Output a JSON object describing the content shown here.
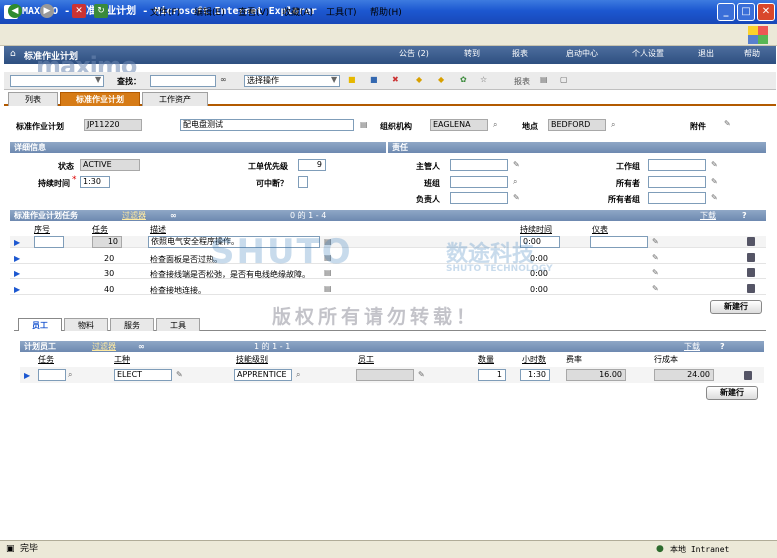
{
  "window": {
    "title": "MAXIMO - 标准作业计划 - Microsoft Internet Explorer"
  },
  "menu": [
    "文件(F)",
    "编辑(E)",
    "查看(V)",
    "收藏(A)",
    "工具(T)",
    "帮助(H)"
  ],
  "app": {
    "title": "标准作业计划",
    "logo": "maximo",
    "header_links": [
      "公告 (2)",
      "转到",
      "报表",
      "启动中心",
      "个人设置",
      "退出",
      "帮助"
    ]
  },
  "toolbar": {
    "find_label": "查找：",
    "action_value": "选择操作",
    "report_label": "报表"
  },
  "tabs": [
    "列表",
    "标准作业计划",
    "工作资产"
  ],
  "main": {
    "jobplan_label": "标准作业计划",
    "jobplan_value": "JP11220",
    "desc_value": "配电盘测试",
    "org_label": "组织机构",
    "org_value": "EAGLENA",
    "site_label": "地点",
    "site_value": "BEDFORD",
    "attach_label": "附件"
  },
  "details": {
    "title": "详细信息",
    "status_label": "状态",
    "status_value": "ACTIVE",
    "duration_label": "持续时间",
    "duration_value": "1:30",
    "priority_label": "工单优先级",
    "priority_value": "9",
    "interrupt_label": "可中断？"
  },
  "responsibility": {
    "title": "责任",
    "supervisor": "主管人",
    "crew": "班组",
    "lead": "负责人",
    "workgroup": "工作组",
    "owner": "所有者",
    "ownergroup": "所有者组"
  },
  "tasks": {
    "title": "标准作业计划任务",
    "filter": "过滤器",
    "pager": "0 的 1 - 4",
    "download": "下载",
    "columns": [
      "序号",
      "任务",
      "描述",
      "持续时间",
      "仪表"
    ],
    "rows": [
      {
        "task": "10",
        "desc": "依照电气安全程序操作。",
        "duration": "0:00"
      },
      {
        "task": "20",
        "desc": "检查面板是否过热。",
        "duration": "0:00"
      },
      {
        "task": "30",
        "desc": "检查接线端是否松弛，是否有电线绝缘故障。",
        "duration": "0:00"
      },
      {
        "task": "40",
        "desc": "检查接地连接。",
        "duration": "0:00"
      }
    ],
    "new_row": "新建行"
  },
  "watermark": {
    "brand": "SHUTO",
    "cn": "数途科技",
    "en": "SHUTO TECHNOLOGY",
    "notice": "版权所有请勿转载！"
  },
  "subtabs": [
    "员工",
    "物料",
    "服务",
    "工具"
  ],
  "labor": {
    "title": "计划员工",
    "filter": "过滤器",
    "pager": "1 的 1 - 1",
    "download": "下载",
    "columns": [
      "任务",
      "工种",
      "技能级别",
      "员工",
      "数量",
      "小时数",
      "费率",
      "行成本"
    ],
    "row": {
      "craft": "ELECT",
      "skill": "APPRENTICE",
      "qty": "1",
      "hours": "1:30",
      "rate": "16.00",
      "cost": "24.00"
    },
    "new_row": "新建行"
  },
  "status": {
    "left": "完毕",
    "right": "本地 Intranet"
  }
}
